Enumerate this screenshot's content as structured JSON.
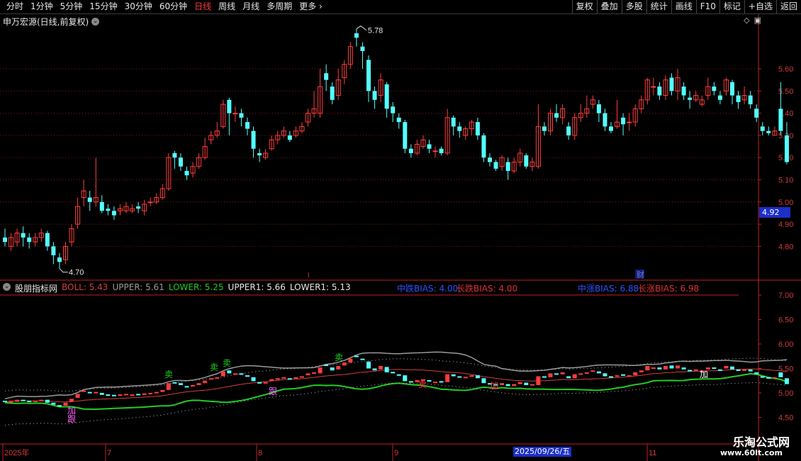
{
  "toolbar": {
    "periods": [
      "分时",
      "1分钟",
      "5分钟",
      "15分钟",
      "30分钟",
      "60分钟",
      "日线",
      "周线",
      "月线",
      "多周期",
      "更多"
    ],
    "active_period": "日线",
    "more_arrow": "›",
    "right_buttons": [
      "复权",
      "叠加",
      "多股",
      "统计",
      "画线",
      "F10",
      "标记",
      "+自选",
      "返回"
    ]
  },
  "main_chart": {
    "title": "申万宏源(日线,前复权)",
    "price_labels": [
      "5.60",
      "5.50",
      "5.40",
      "5.30",
      "5.20",
      "5.10",
      "5.00",
      "4.90",
      "4.80"
    ],
    "high_annotation": "5.78",
    "low_annotation": "4.70",
    "current_price": "4.92",
    "event_markers": [
      "财"
    ],
    "candles": [
      [
        4.84,
        4.82,
        4.88,
        4.8
      ],
      [
        4.8,
        4.84,
        4.86,
        4.78
      ],
      [
        4.82,
        4.86,
        4.88,
        4.8
      ],
      [
        4.86,
        4.84,
        4.89,
        4.8
      ],
      [
        4.84,
        4.82,
        4.86,
        4.79
      ],
      [
        4.82,
        4.84,
        4.86,
        4.8
      ],
      [
        4.84,
        4.86,
        4.88,
        4.82
      ],
      [
        4.86,
        4.8,
        4.87,
        4.78
      ],
      [
        4.8,
        4.76,
        4.82,
        4.72
      ],
      [
        4.75,
        4.73,
        4.77,
        4.7
      ],
      [
        4.74,
        4.8,
        4.82,
        4.72
      ],
      [
        4.82,
        4.88,
        4.9,
        4.8
      ],
      [
        4.9,
        4.98,
        5.02,
        4.88
      ],
      [
        5.02,
        5.05,
        5.1,
        4.98
      ],
      [
        5.02,
        5.0,
        5.05,
        4.96
      ],
      [
        5.0,
        5.02,
        5.2,
        4.98
      ],
      [
        5.0,
        4.96,
        5.03,
        4.95
      ],
      [
        4.97,
        4.96,
        4.99,
        4.94
      ],
      [
        4.96,
        4.94,
        4.98,
        4.92
      ],
      [
        4.96,
        4.97,
        4.99,
        4.94
      ],
      [
        4.96,
        4.98,
        5.0,
        4.95
      ],
      [
        4.96,
        4.97,
        4.99,
        4.95
      ],
      [
        4.98,
        4.97,
        5.0,
        4.95
      ],
      [
        4.96,
        4.99,
        5.01,
        4.94
      ],
      [
        5.0,
        5.0,
        5.02,
        4.98
      ],
      [
        5.0,
        5.02,
        5.04,
        4.99
      ],
      [
        5.02,
        5.06,
        5.08,
        5.01
      ],
      [
        5.06,
        5.2,
        5.22,
        5.05
      ],
      [
        5.22,
        5.2,
        5.23,
        5.15
      ],
      [
        5.2,
        5.16,
        5.22,
        5.14
      ],
      [
        5.14,
        5.12,
        5.16,
        5.1
      ],
      [
        5.13,
        5.16,
        5.18,
        5.11
      ],
      [
        5.16,
        5.2,
        5.22,
        5.15
      ],
      [
        5.2,
        5.25,
        5.29,
        5.19
      ],
      [
        5.28,
        5.3,
        5.32,
        5.26
      ],
      [
        5.3,
        5.32,
        5.36,
        5.29
      ],
      [
        5.34,
        5.44,
        5.46,
        5.33
      ],
      [
        5.46,
        5.4,
        5.47,
        5.3
      ],
      [
        5.4,
        5.4,
        5.43,
        5.36
      ],
      [
        5.4,
        5.38,
        5.42,
        5.34
      ],
      [
        5.36,
        5.33,
        5.38,
        5.3
      ],
      [
        5.32,
        5.24,
        5.34,
        5.2
      ],
      [
        5.22,
        5.21,
        5.24,
        5.18
      ],
      [
        5.2,
        5.22,
        5.24,
        5.19
      ],
      [
        5.24,
        5.28,
        5.3,
        5.23
      ],
      [
        5.28,
        5.3,
        5.32,
        5.26
      ],
      [
        5.3,
        5.32,
        5.34,
        5.29
      ],
      [
        5.3,
        5.28,
        5.32,
        5.27
      ],
      [
        5.3,
        5.32,
        5.34,
        5.29
      ],
      [
        5.32,
        5.34,
        5.36,
        5.31
      ],
      [
        5.36,
        5.4,
        5.42,
        5.34
      ],
      [
        5.4,
        5.42,
        5.5,
        5.38
      ],
      [
        5.4,
        5.52,
        5.6,
        5.38
      ],
      [
        5.58,
        5.55,
        5.62,
        5.5
      ],
      [
        5.52,
        5.46,
        5.54,
        5.44
      ],
      [
        5.48,
        5.55,
        5.6,
        5.46
      ],
      [
        5.56,
        5.62,
        5.64,
        5.53
      ],
      [
        5.62,
        5.7,
        5.72,
        5.6
      ],
      [
        5.76,
        5.74,
        5.78,
        5.7
      ],
      [
        5.7,
        5.68,
        5.72,
        5.6
      ],
      [
        5.64,
        5.5,
        5.66,
        5.45
      ],
      [
        5.5,
        5.46,
        5.52,
        5.42
      ],
      [
        5.48,
        5.55,
        5.58,
        5.45
      ],
      [
        5.53,
        5.42,
        5.54,
        5.38
      ],
      [
        5.43,
        5.4,
        5.45,
        5.36
      ],
      [
        5.38,
        5.36,
        5.4,
        5.33
      ],
      [
        5.36,
        5.24,
        5.37,
        5.22
      ],
      [
        5.24,
        5.22,
        5.26,
        5.2
      ],
      [
        5.22,
        5.26,
        5.28,
        5.21
      ],
      [
        5.25,
        5.28,
        5.3,
        5.24
      ],
      [
        5.26,
        5.24,
        5.28,
        5.22
      ],
      [
        5.23,
        5.23,
        5.25,
        5.2
      ],
      [
        5.24,
        5.22,
        5.25,
        5.21
      ],
      [
        5.22,
        5.38,
        5.42,
        5.21
      ],
      [
        5.38,
        5.34,
        5.39,
        5.3
      ],
      [
        5.34,
        5.32,
        5.36,
        5.29
      ],
      [
        5.3,
        5.33,
        5.34,
        5.28
      ],
      [
        5.33,
        5.36,
        5.37,
        5.3
      ],
      [
        5.36,
        5.3,
        5.38,
        5.28
      ],
      [
        5.3,
        5.2,
        5.31,
        5.18
      ],
      [
        5.2,
        5.18,
        5.22,
        5.16
      ],
      [
        5.18,
        5.15,
        5.19,
        5.14
      ],
      [
        5.16,
        5.2,
        5.21,
        5.14
      ],
      [
        5.18,
        5.14,
        5.2,
        5.1
      ],
      [
        5.14,
        5.18,
        5.2,
        5.13
      ],
      [
        5.18,
        5.22,
        5.24,
        5.16
      ],
      [
        5.21,
        5.16,
        5.22,
        5.15
      ],
      [
        5.16,
        5.18,
        5.2,
        5.14
      ],
      [
        5.16,
        5.34,
        5.44,
        5.15
      ],
      [
        5.34,
        5.32,
        5.36,
        5.3
      ],
      [
        5.32,
        5.4,
        5.42,
        5.3
      ],
      [
        5.4,
        5.38,
        5.44,
        5.36
      ],
      [
        5.38,
        5.42,
        5.44,
        5.35
      ],
      [
        5.34,
        5.3,
        5.36,
        5.28
      ],
      [
        5.3,
        5.38,
        5.4,
        5.28
      ],
      [
        5.38,
        5.4,
        5.44,
        5.36
      ],
      [
        5.4,
        5.42,
        5.48,
        5.38
      ],
      [
        5.44,
        5.46,
        5.48,
        5.42
      ],
      [
        5.44,
        5.4,
        5.46,
        5.36
      ],
      [
        5.4,
        5.34,
        5.42,
        5.32
      ],
      [
        5.34,
        5.32,
        5.36,
        5.31
      ],
      [
        5.34,
        5.36,
        5.46,
        5.33
      ],
      [
        5.38,
        5.35,
        5.4,
        5.3
      ],
      [
        5.36,
        5.36,
        5.4,
        5.32
      ],
      [
        5.36,
        5.42,
        5.44,
        5.34
      ],
      [
        5.42,
        5.46,
        5.48,
        5.4
      ],
      [
        5.46,
        5.55,
        5.56,
        5.44
      ],
      [
        5.52,
        5.52,
        5.56,
        5.48
      ],
      [
        5.52,
        5.48,
        5.54,
        5.46
      ],
      [
        5.48,
        5.55,
        5.57,
        5.46
      ],
      [
        5.56,
        5.5,
        5.58,
        5.48
      ],
      [
        5.5,
        5.56,
        5.6,
        5.46
      ],
      [
        5.52,
        5.48,
        5.54,
        5.46
      ],
      [
        5.47,
        5.46,
        5.5,
        5.42
      ],
      [
        5.46,
        5.48,
        5.5,
        5.45
      ],
      [
        5.44,
        5.46,
        5.48,
        5.43
      ],
      [
        5.48,
        5.52,
        5.56,
        5.46
      ],
      [
        5.52,
        5.5,
        5.54,
        5.48
      ],
      [
        5.48,
        5.46,
        5.5,
        5.44
      ],
      [
        5.5,
        5.55,
        5.56,
        5.48
      ],
      [
        5.54,
        5.48,
        5.55,
        5.44
      ],
      [
        5.48,
        5.45,
        5.5,
        5.42
      ],
      [
        5.46,
        5.48,
        5.52,
        5.44
      ],
      [
        5.48,
        5.44,
        5.5,
        5.42
      ],
      [
        5.42,
        5.38,
        5.44,
        5.36
      ],
      [
        5.34,
        5.32,
        5.36,
        5.3
      ],
      [
        5.32,
        5.31,
        5.34,
        5.3
      ],
      [
        5.3,
        5.32,
        5.34,
        5.3
      ],
      [
        5.42,
        5.32,
        5.54,
        5.3
      ],
      [
        5.3,
        5.18,
        5.36,
        5.17
      ]
    ]
  },
  "indicator": {
    "name": "股朋指标网",
    "boll": "BOLL: 5.43",
    "upper": "UPPER: 5.61",
    "lower": "LOWER: 5.25",
    "upper1": "UPPER1: 5.66",
    "lower1": "LOWER1: 5.13",
    "mid_fall_bias": "中跌BIAS: 4.00",
    "long_fall_bias": "长跌BIAS: 4.00",
    "mid_rise_bias": "中涨BIAS: 6.88",
    "long_rise_bias": "长涨BIAS: 6.98",
    "axis_labels": [
      "7.00",
      "6.50",
      "6.00",
      "5.50",
      "5.00",
      "4.50"
    ],
    "signals": [
      "卖",
      "卖",
      "卖",
      "卖",
      "跟",
      "加",
      "跟",
      "加",
      "卖",
      "加"
    ],
    "colors": {
      "boll": "#d23f3f",
      "upper": "#9a9a9a",
      "lower": "#22cc22",
      "bias_blue": "#2a52ff",
      "bias_red": "#e03030"
    }
  },
  "date_axis": {
    "labels": [
      "2025年",
      "7",
      "8",
      "9",
      "11"
    ],
    "selected_date": "2025/09/26/五"
  },
  "watermark": {
    "line1": "乐淘公式网",
    "line2": "www.60lt.com"
  },
  "colors": {
    "up": "#ff3d3d",
    "down": "#54ffff",
    "grid": "#7a1a1a",
    "axis_text": "#d23a3a"
  }
}
